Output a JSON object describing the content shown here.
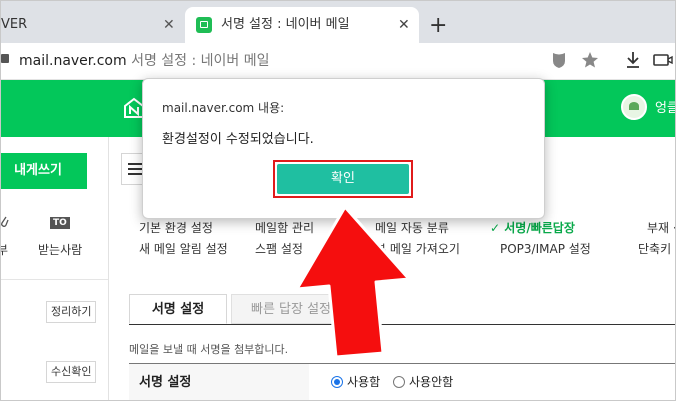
{
  "browser": {
    "tabs": [
      {
        "label": "VER",
        "close": "✕"
      },
      {
        "label": "서명 설정 : 네이버 메일",
        "close": "✕"
      }
    ],
    "new_tab": "+",
    "address": {
      "domain": "mail.naver.com",
      "page_title": "서명 설정 : 네이버 메일"
    }
  },
  "header": {
    "user_name": "엉클"
  },
  "sidebar": {
    "compose_label": "내게쓰기",
    "to_badge": "TO",
    "label_attach_partial": "부",
    "label_recipient": "받는사람",
    "btn_cleanup": "정리하기",
    "btn_read_receipt": "수신확인"
  },
  "settings_menu": {
    "row1": [
      "기본 환경 설정",
      "메일함 관리",
      "메일 자동 분류",
      "✓ 서명/빠른답장",
      "부재 ·"
    ],
    "row2": [
      "새 메일 알림 설정",
      "스팸 설정",
      "외부 메일 가져오기",
      "POP3/IMAP 설정",
      "단축키"
    ],
    "row2_visible": [
      "새 메일 알림 설정",
      "스팸 설정",
      "부 메일 가져오기",
      "POP3/IMAP 설정",
      "단축키"
    ]
  },
  "content": {
    "tabs": [
      "서명 설정",
      "빠른 답장 설정"
    ],
    "description": "메일을 보낼 때 서명을 첨부합니다.",
    "row_label": "서명 설정",
    "options": [
      "사용함",
      "사용안함"
    ],
    "selected_option": "사용함"
  },
  "dialog": {
    "title": "mail.naver.com 내용:",
    "message": "환경설정이 수정되었습니다.",
    "ok_label": "확인"
  },
  "colors": {
    "naver_green": "#03c75a",
    "ok_button": "#1fbfa1",
    "highlight_red": "#e01b1b"
  }
}
